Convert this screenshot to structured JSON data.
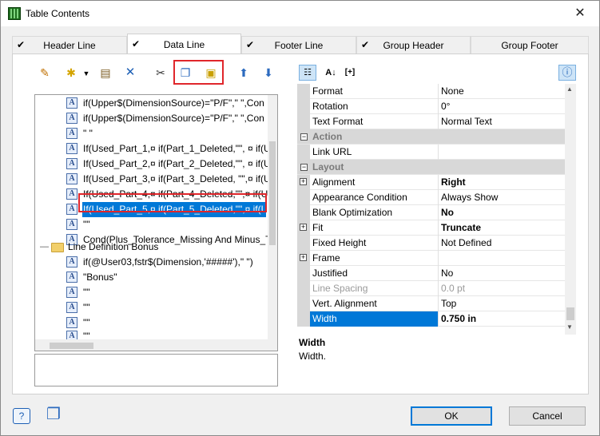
{
  "window": {
    "title": "Table Contents",
    "close_glyph": "✕"
  },
  "tabs": [
    {
      "label": "Header Line",
      "checked": true
    },
    {
      "label": "Data Line",
      "checked": true,
      "active": true
    },
    {
      "label": "Footer Line",
      "checked": true
    },
    {
      "label": "Group Header",
      "checked": true
    },
    {
      "label": "Group Footer",
      "checked": false
    }
  ],
  "toolbar_icons": [
    "wizard-icon",
    "new-item-icon",
    "dropdown-arrow-icon",
    "edit-properties-icon",
    "delete-icon",
    "cut-icon",
    "copy-icon",
    "paste-icon",
    "move-up-icon",
    "move-down-icon"
  ],
  "tree": {
    "rows": [
      {
        "text": "if(Upper$(DimensionSource)=\"P/F\",\" \",Con",
        "type": "field"
      },
      {
        "text": "if(Upper$(DimensionSource)=\"P/F\",\" \",Con",
        "type": "field"
      },
      {
        "text": "\" \"",
        "type": "field"
      },
      {
        "text": "If(Used_Part_1,¤ if(Part_1_Deleted,\"\", ¤  if(U",
        "type": "field"
      },
      {
        "text": "If(Used_Part_2,¤ if(Part_2_Deleted,\"\", ¤  if(U",
        "type": "field"
      },
      {
        "text": "If(Used_Part_3,¤ if(Part_3_Deleted, \"\",¤  if(U",
        "type": "field"
      },
      {
        "text": "If(Used_Part_4,¤ if(Part_4_Deleted,\"\",¤  if(U",
        "type": "field"
      },
      {
        "text": "If(Used_Part_5,¤ if(Part_5_Deleted,\"\",¤  if(U",
        "type": "field",
        "selected": true
      },
      {
        "text": "\"\"",
        "type": "field"
      },
      {
        "text": "Cond(Plus_Tolerance_Missing And Minus_T",
        "type": "field"
      },
      {
        "text": "Line Definition Bonus",
        "type": "folder"
      },
      {
        "text": "if(@User03,fstr$(Dimension,'#####'),\" \")",
        "type": "field"
      },
      {
        "text": "\"Bonus\"",
        "type": "field"
      },
      {
        "text": "\"\"",
        "type": "field"
      },
      {
        "text": "\"\"",
        "type": "field"
      },
      {
        "text": "\"\"",
        "type": "field"
      },
      {
        "text": "\"\"",
        "type": "field"
      }
    ]
  },
  "property_toolbar": {
    "sort_label": "[+]"
  },
  "properties": [
    {
      "name": "Format",
      "value": "None"
    },
    {
      "name": "Rotation",
      "value": "0°"
    },
    {
      "name": "Text Format",
      "value": "Normal Text"
    },
    {
      "category": "Action"
    },
    {
      "name": "Link URL",
      "value": ""
    },
    {
      "category": "Layout"
    },
    {
      "name": "Alignment",
      "value": "Right",
      "bold": true,
      "expandable": true
    },
    {
      "name": "Appearance Condition",
      "value": "Always Show"
    },
    {
      "name": "Blank Optimization",
      "value": "No",
      "bold": true
    },
    {
      "name": "Fit",
      "value": "Truncate",
      "bold": true,
      "expandable": true
    },
    {
      "name": "Fixed Height",
      "value": "Not Defined"
    },
    {
      "name": "Frame",
      "value": "",
      "expandable": true
    },
    {
      "name": "Justified",
      "value": "No"
    },
    {
      "name": "Line Spacing",
      "value": "0.0 pt",
      "disabled": true
    },
    {
      "name": "Vert. Alignment",
      "value": "Top"
    },
    {
      "name": "Width",
      "value": "0.750 in",
      "bold": true,
      "selected": true
    }
  ],
  "help": {
    "title": "Width",
    "text": "Width."
  },
  "buttons": {
    "ok": "OK",
    "cancel": "Cancel"
  },
  "colors": {
    "selection": "#0078d7",
    "highlight_box": "#e0262b"
  }
}
